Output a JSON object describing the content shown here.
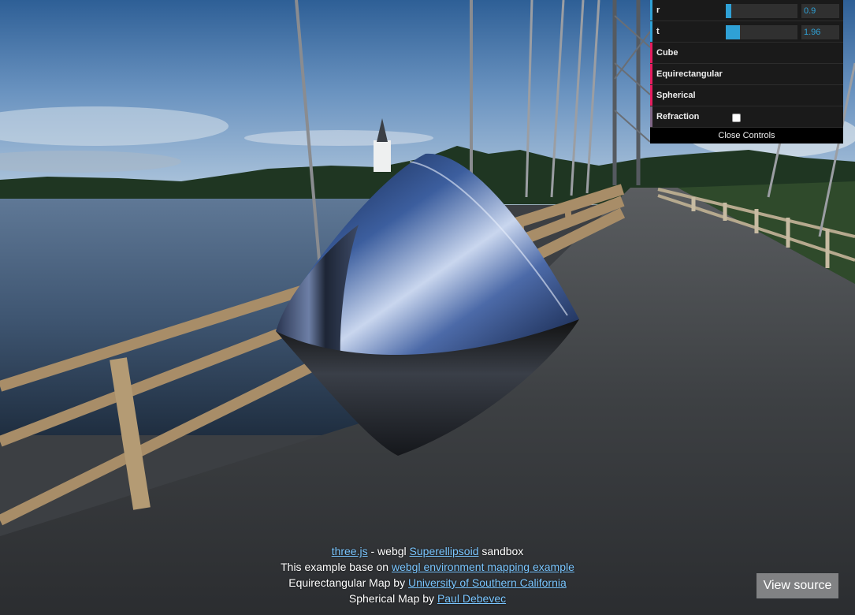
{
  "gui": {
    "params": [
      {
        "label": "r",
        "value": "0.9",
        "fraction": 0.08
      },
      {
        "label": "t",
        "value": "1.96",
        "fraction": 0.2
      }
    ],
    "maps": [
      "Cube",
      "Equirectangular",
      "Spherical"
    ],
    "refraction_label": "Refraction",
    "refraction_checked": false,
    "close_label": "Close Controls",
    "colors": {
      "number": "#2fa1d6",
      "function": "#e61d5f",
      "boolean": "#806787"
    }
  },
  "info": {
    "line1": {
      "link1": "three.js",
      "text1": " - webgl ",
      "link2": "Superellipsoid",
      "text2": " sandbox"
    },
    "line2": {
      "text": "This example base on ",
      "link": "webgl environment mapping example"
    },
    "line3": {
      "text": "Equirectangular Map by ",
      "link": "University of Southern California"
    },
    "line4": {
      "text": "Spherical Map by ",
      "link": "Paul Debevec"
    }
  },
  "view_source_label": "View source"
}
